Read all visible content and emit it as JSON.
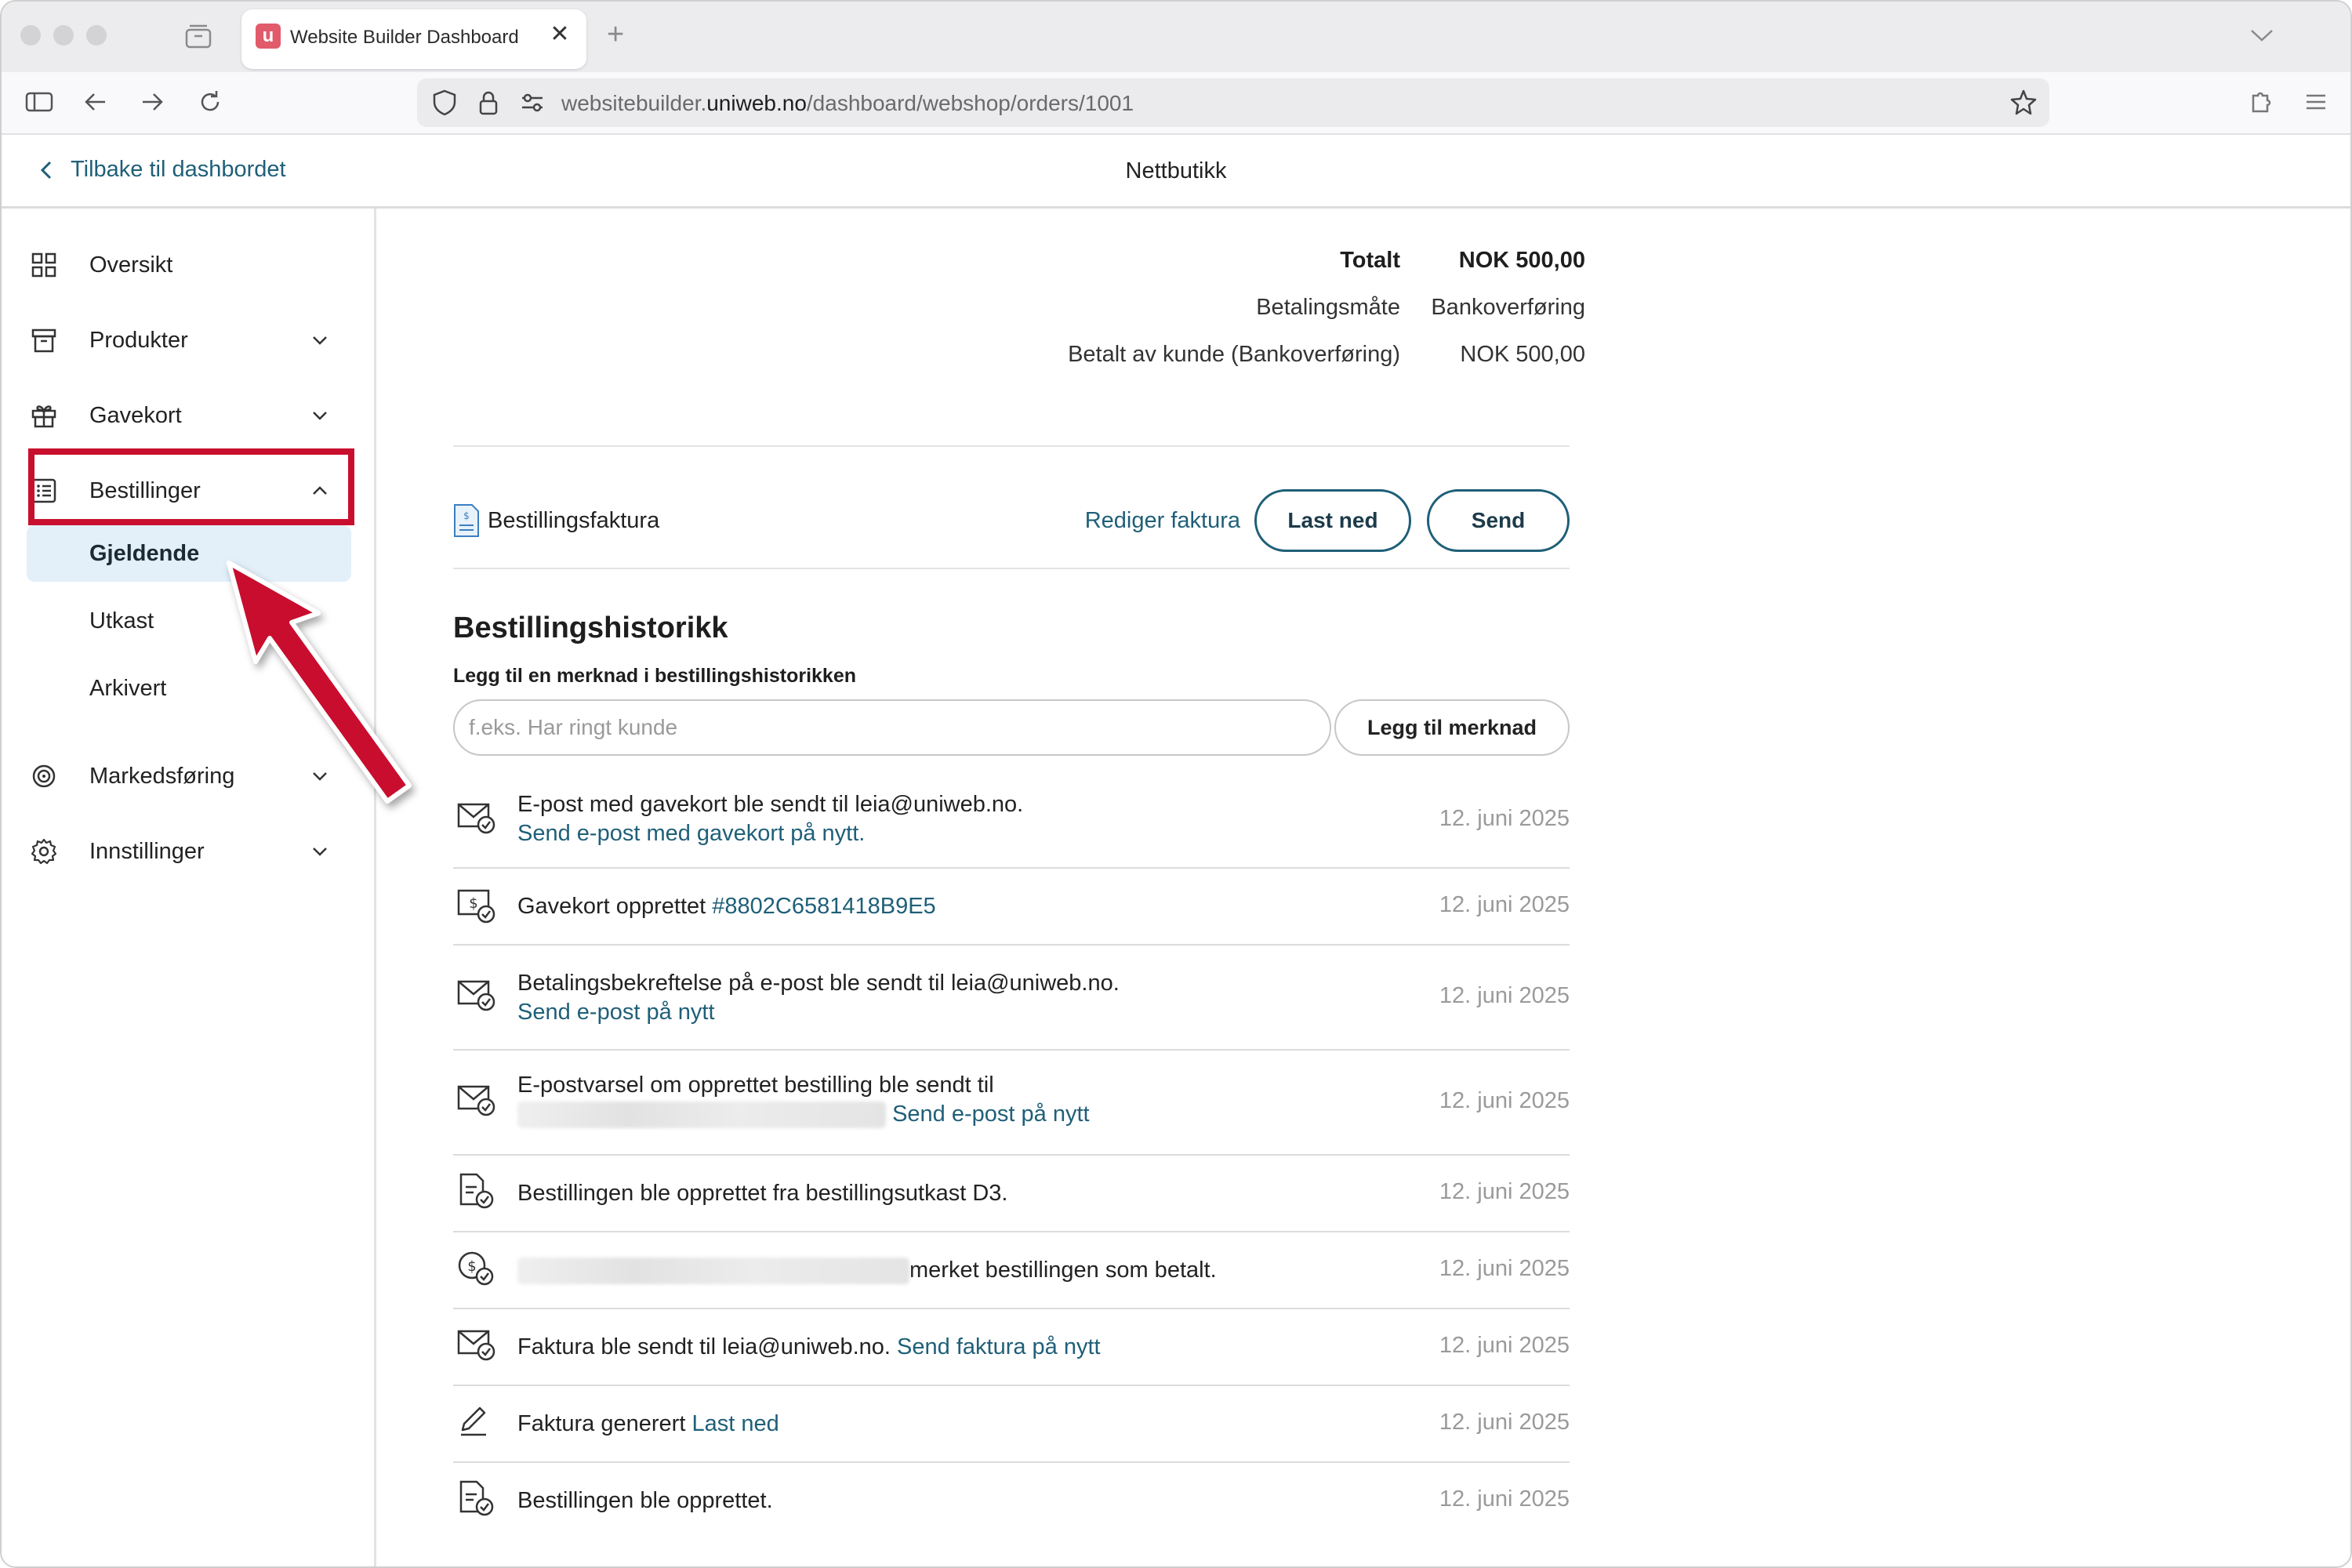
{
  "browser": {
    "tab_title": "Website Builder Dashboard",
    "tab_favicon": "u",
    "tab_close": "✕",
    "tab_new": "+",
    "url_prefix": "websitebuilder.",
    "url_domain": "uniweb.no",
    "url_path": "/dashboard/webshop/orders/1001"
  },
  "header": {
    "back_label": "Tilbake til dashbordet",
    "title": "Nettbutikk"
  },
  "sidebar": {
    "items": [
      {
        "label": "Oversikt",
        "icon": "grid-icon"
      },
      {
        "label": "Produkter",
        "icon": "box-icon"
      },
      {
        "label": "Gavekort",
        "icon": "gift-icon"
      },
      {
        "label": "Bestillinger",
        "icon": "list-icon"
      },
      {
        "label": "Markedsføring",
        "icon": "target-icon"
      },
      {
        "label": "Innstillinger",
        "icon": "gear-icon"
      }
    ],
    "orders_sub": [
      "Gjeldende",
      "Utkast",
      "Arkivert"
    ],
    "highlight_color": "#c8102e"
  },
  "summary": {
    "total_label": "Totalt",
    "total_value": "NOK 500,00",
    "payment_method_label": "Betalingsmåte",
    "payment_method_value": "Bankoverføring",
    "paid_label": "Betalt av kunde (Bankoverføring)",
    "paid_value": "NOK 500,00"
  },
  "invoice": {
    "label": "Bestillingsfaktura",
    "edit_label": "Rediger faktura",
    "download_label": "Last ned",
    "send_label": "Send"
  },
  "history": {
    "title": "Bestillingshistorikk",
    "note_label": "Legg til en merknad i bestillingshistorikken",
    "note_placeholder": "f.eks. Har ringt kunde",
    "note_button": "Legg til merknad",
    "items": [
      {
        "icon": "mail-check-icon",
        "text": "E-post med gavekort ble sendt til leia@uniweb.no.",
        "link": "Send e-post med gavekort på nytt.",
        "date": "12. juni 2025"
      },
      {
        "icon": "giftcard-check-icon",
        "text": "Gavekort opprettet ",
        "link": "#8802C6581418B9E5",
        "date": "12. juni 2025"
      },
      {
        "icon": "mail-check-icon",
        "text": "Betalingsbekreftelse på e-post ble sendt til leia@uniweb.no.",
        "link": "Send e-post på nytt",
        "date": "12. juni 2025"
      },
      {
        "icon": "mail-check-icon",
        "text": "E-postvarsel om opprettet bestilling ble sendt til",
        "link": "Send e-post på nytt",
        "date": "12. juni 2025"
      },
      {
        "icon": "document-check-icon",
        "text": "Bestillingen ble opprettet fra bestillingsutkast D3.",
        "link": "",
        "date": "12. juni 2025"
      },
      {
        "icon": "coin-check-icon",
        "text": "merket bestillingen som betalt.",
        "link": "",
        "date": "12. juni 2025"
      },
      {
        "icon": "mail-check-icon",
        "text": "Faktura ble sendt til leia@uniweb.no. ",
        "link": "Send faktura på nytt",
        "date": "12. juni 2025"
      },
      {
        "icon": "pencil-icon",
        "text": "Faktura generert ",
        "link": "Last ned",
        "date": "12. juni 2025"
      },
      {
        "icon": "document-check-icon",
        "text": "Bestillingen ble opprettet.",
        "link": "",
        "date": "12. juni 2025"
      }
    ]
  },
  "colors": {
    "link": "#1f5f78",
    "active_bg": "#e3f0fa",
    "annotation": "#c8102e"
  }
}
